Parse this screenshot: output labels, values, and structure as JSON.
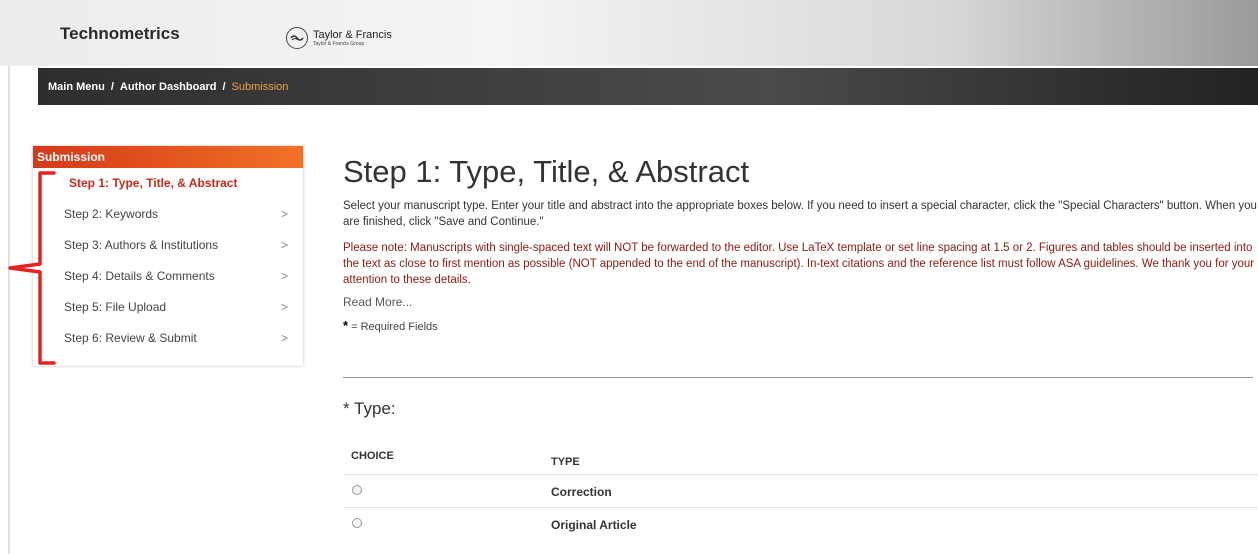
{
  "header": {
    "journal_title": "Technometrics",
    "publisher_name": "Taylor & Francis",
    "publisher_sub": "Taylor & Francis Group"
  },
  "breadcrumb": {
    "items": [
      "Main Menu",
      "Author Dashboard",
      "Submission"
    ],
    "separator": "/"
  },
  "sidebar": {
    "header": "Submission",
    "steps": [
      {
        "label": "Step 1: Type, Title, & Abstract",
        "active": true
      },
      {
        "label": "Step 2: Keywords",
        "chevron": ">"
      },
      {
        "label": "Step 3: Authors & Institutions",
        "chevron": ">"
      },
      {
        "label": "Step 4: Details & Comments",
        "chevron": ">"
      },
      {
        "label": "Step 5: File Upload",
        "chevron": ">"
      },
      {
        "label": "Step 6: Review & Submit",
        "chevron": ">"
      }
    ]
  },
  "main": {
    "title": "Step 1: Type, Title, & Abstract",
    "intro": "Select your manuscript type. Enter your title and abstract into the appropriate boxes below. If you need to insert a special character, click the \"Special Characters\" button. When you are finished, click \"Save and Continue.\"",
    "note": "Please note: Manuscripts with single-spaced text will NOT be forwarded to the editor. Use LaTeX template or set line spacing at 1.5 or 2. Figures and tables should be inserted into the text as close to first mention as possible (NOT appended to the end of the manuscript). In-text citations and the reference list must follow ASA guidelines. We thank you for your attention to these details.",
    "read_more": "Read More...",
    "required_star": "*",
    "required_text": "= Required Fields",
    "type_label": "* Type:",
    "table": {
      "headers": [
        "CHOICE",
        "TYPE"
      ],
      "rows": [
        {
          "type": "Correction"
        },
        {
          "type": "Original Article"
        }
      ]
    }
  },
  "colors": {
    "accent_red": "#c62a1a",
    "sidebar_header": "#e65a1e",
    "breadcrumb_current": "#f0a24a",
    "annotation_bracket": "#e52222"
  },
  "icons": [
    "taylor-francis-logo-icon",
    "chevron-right-icon",
    "radio-icon"
  ]
}
